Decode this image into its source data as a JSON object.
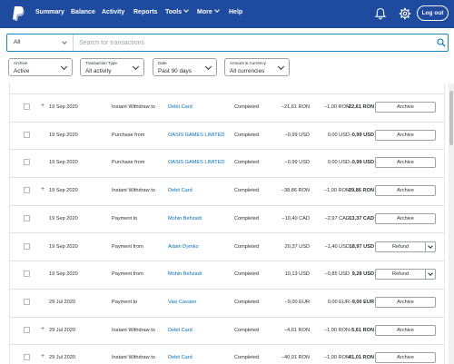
{
  "nav": {
    "items": [
      {
        "label": "Summary"
      },
      {
        "label": "Balance"
      },
      {
        "label": "Activity"
      },
      {
        "label": "Reports"
      },
      {
        "label": "Tools"
      },
      {
        "label": "More"
      },
      {
        "label": "Help"
      }
    ],
    "logout": "Log out",
    "colors": {
      "bar": "#1f4b9e",
      "link": "#0070ba"
    }
  },
  "search": {
    "scope": "All",
    "placeholder": "Search for transactions",
    "value": ""
  },
  "filters": [
    {
      "label": "Archive",
      "value": "Active"
    },
    {
      "label": "Transaction Type",
      "value": "All activity"
    },
    {
      "label": "Date",
      "value": "Past 90 days"
    },
    {
      "label": "Amount & Currency",
      "value": "All currencies"
    }
  ],
  "rows": [
    {
      "date": "19 Sep 2020",
      "type": "Instant Withdraw to",
      "party": "Debit Card",
      "status": "Completed",
      "gross": "−21,61 RON",
      "fee": "−1,00 RON",
      "net": "-22,61 RON",
      "action": "Archive"
    },
    {
      "date": "19 Sep 2020",
      "type": "Purchase from",
      "party": "OASIS GAMES LIMITED",
      "status": "Completed",
      "gross": "−0,99 USD",
      "fee": "0,00 USD",
      "net": "-0,99 USD",
      "action": "Archive"
    },
    {
      "date": "19 Sep 2020",
      "type": "Purchase from",
      "party": "OASIS GAMES LIMITED",
      "status": "Completed",
      "gross": "−0,99 USD",
      "fee": "0,00 USD",
      "net": "-0,99 USD",
      "action": "Archive"
    },
    {
      "date": "19 Sep 2020",
      "type": "Instant Withdraw to",
      "party": "Debit Card",
      "status": "Completed",
      "gross": "−38,86 RON",
      "fee": "−1,00 RON",
      "net": "-39,86 RON",
      "action": "Archive"
    },
    {
      "date": "19 Sep 2020",
      "type": "Payment to",
      "party": "Mohin Behzadi",
      "status": "Completed",
      "gross": "−10,40 CAD",
      "fee": "−2,97 CAD",
      "net": "-13,37 CAD",
      "action": "Archive"
    },
    {
      "date": "19 Sep 2020",
      "type": "Payment from",
      "party": "Adam Dymko",
      "status": "Completed",
      "gross": "20,37 USD",
      "fee": "−1,40 USD",
      "net": "18,97 USD",
      "action": "Refund"
    },
    {
      "date": "19 Sep 2020",
      "type": "Payment from",
      "party": "Mohin Behzadi",
      "status": "Completed",
      "gross": "10,13 USD",
      "fee": "−0,85 USD",
      "net": "9,28 USD",
      "action": "Refund"
    },
    {
      "date": "29 Jul 2020",
      "type": "Payment to",
      "party": "Vasi Cavater",
      "status": "Completed",
      "gross": "−9,00 EUR",
      "fee": "0,00 EUR",
      "net": "-9,00 EUR",
      "action": "Archive"
    },
    {
      "date": "29 Jul 2020",
      "type": "Instant Withdraw to",
      "party": "Debit Card",
      "status": "Completed",
      "gross": "−4,61 RON",
      "fee": "−1,00 RON",
      "net": "-5,61 RON",
      "action": "Archive"
    },
    {
      "date": "29 Jul 2020",
      "type": "Instant Withdraw to",
      "party": "Debit Card",
      "status": "Completed",
      "gross": "−40,01 RON",
      "fee": "−1,00 RON",
      "net": "-41,01 RON",
      "action": "Archive"
    }
  ]
}
